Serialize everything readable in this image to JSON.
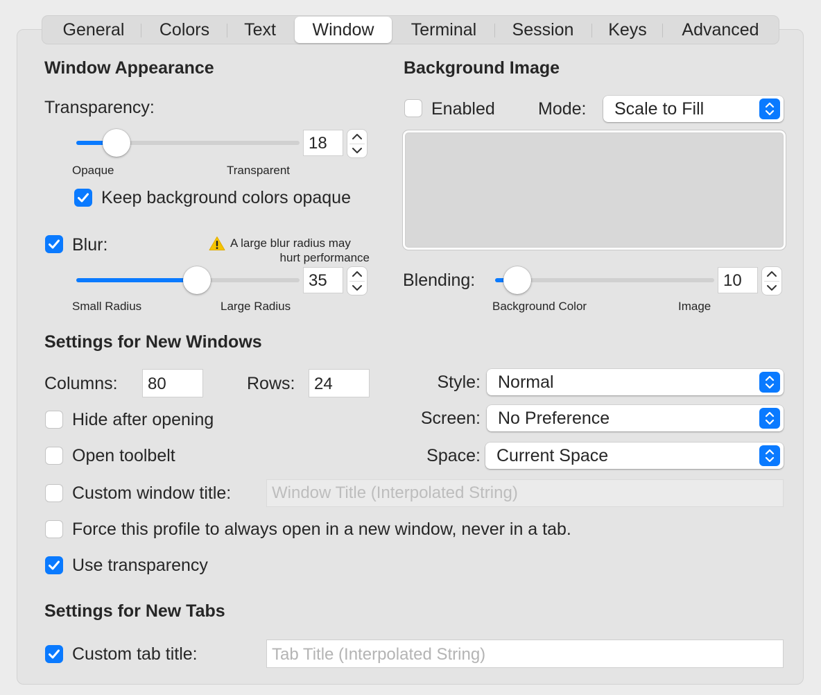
{
  "tabs": [
    {
      "label": "General"
    },
    {
      "label": "Colors"
    },
    {
      "label": "Text"
    },
    {
      "label": "Window"
    },
    {
      "label": "Terminal"
    },
    {
      "label": "Session"
    },
    {
      "label": "Keys"
    },
    {
      "label": "Advanced"
    }
  ],
  "active_tab": "Window",
  "window_appearance": {
    "heading": "Window Appearance",
    "transparency_label": "Transparency:",
    "transparency_value": "18",
    "transparency_level": 0.18,
    "transparency_min_label": "Opaque",
    "transparency_max_label": "Transparent",
    "keep_bg_opaque_label": "Keep background colors opaque",
    "keep_bg_opaque_checked": true,
    "blur_label": "Blur:",
    "blur_checked": true,
    "blur_warning_line1": "A large blur radius may",
    "blur_warning_line2": "hurt performance",
    "blur_value": "35",
    "blur_level": 0.54,
    "blur_min_label": "Small Radius",
    "blur_max_label": "Large Radius"
  },
  "background_image": {
    "heading": "Background Image",
    "enabled_label": "Enabled",
    "enabled_checked": false,
    "mode_label": "Mode:",
    "mode_value": "Scale to Fill",
    "blending_label": "Blending:",
    "blending_value": "10",
    "blending_level": 0.1,
    "blending_min_label": "Background Color",
    "blending_max_label": "Image"
  },
  "new_windows": {
    "heading": "Settings for New Windows",
    "columns_label": "Columns:",
    "columns_value": "80",
    "rows_label": "Rows:",
    "rows_value": "24",
    "style_label": "Style:",
    "style_value": "Normal",
    "screen_label": "Screen:",
    "screen_value": "No Preference",
    "space_label": "Space:",
    "space_value": "Current Space",
    "hide_after_opening_label": "Hide after opening",
    "hide_after_opening_checked": false,
    "open_toolbelt_label": "Open toolbelt",
    "open_toolbelt_checked": false,
    "custom_window_title_label": "Custom window title:",
    "custom_window_title_checked": false,
    "custom_window_title_placeholder": "Window Title (Interpolated String)",
    "force_new_window_label": "Force this profile to always open in a new window, never in a tab.",
    "force_new_window_checked": false,
    "use_transparency_label": "Use transparency",
    "use_transparency_checked": true
  },
  "new_tabs": {
    "heading": "Settings for New Tabs",
    "custom_tab_title_label": "Custom tab title:",
    "custom_tab_title_checked": true,
    "custom_tab_title_placeholder": "Tab Title (Interpolated String)"
  },
  "colors": {
    "accent": "#0a7aff",
    "warning": "#f5c400"
  },
  "icons": {
    "checkmark": "checkmark-icon",
    "warning": "warning-icon",
    "stepper_up": "chevron-up-icon",
    "stepper_down": "chevron-down-icon",
    "popup": "up-down-chevron-icon"
  }
}
